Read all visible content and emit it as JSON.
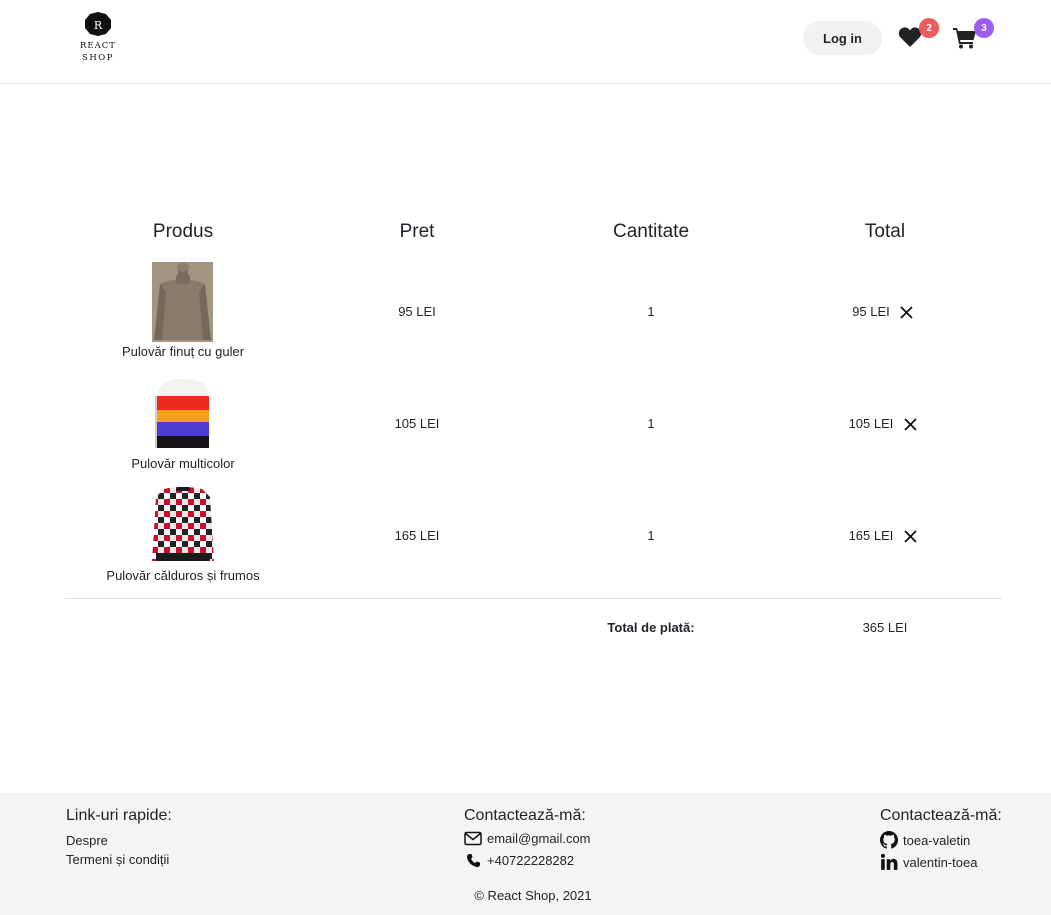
{
  "header": {
    "logo": {
      "letter": "R",
      "line1": "REACT",
      "line2": "SHOP"
    },
    "login_label": "Log in",
    "favorites_count": "2",
    "cart_count": "3",
    "colors": {
      "fav_badge": "#ec5c5c",
      "cart_badge": "#9b5cf0"
    }
  },
  "cart": {
    "columns": [
      "Produs",
      "Pret",
      "Cantitate",
      "Total"
    ],
    "items": [
      {
        "name": "Pulovăr finuț cu guler",
        "price": "95 LEI",
        "quantity": "1",
        "total": "95 LEI",
        "image": "beige-turtleneck-sweater"
      },
      {
        "name": "Pulovăr multicolor",
        "price": "105 LEI",
        "quantity": "1",
        "total": "105 LEI",
        "image": "striped-multicolor-sweater"
      },
      {
        "name": "Pulovăr călduros și frumos",
        "price": "165 LEI",
        "quantity": "1",
        "total": "165 LEI",
        "image": "checkered-red-sweater"
      }
    ],
    "total_label": "Total de plată:",
    "total_value": "365 LEI"
  },
  "footer": {
    "quick_links": {
      "title": "Link-uri rapide:",
      "links": [
        "Despre",
        "Termeni și condiții"
      ]
    },
    "contact": {
      "title": "Contactează-mă:",
      "email": "email@gmail.com",
      "phone": "+40722228282"
    },
    "social": {
      "title": "Contactează-mă:",
      "github": "toea-valetin",
      "linkedin": "valentin-toea"
    },
    "copyright": "© React Shop, 2021"
  }
}
